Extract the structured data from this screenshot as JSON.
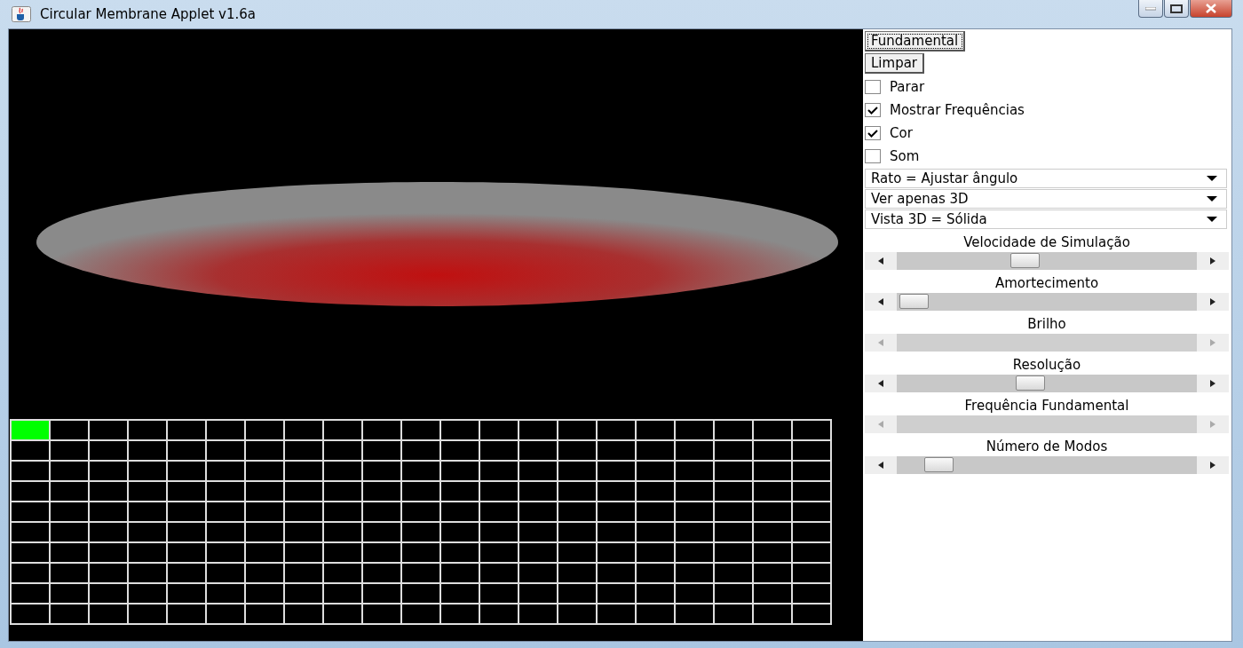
{
  "window": {
    "title": "Circular Membrane Applet v1.6a"
  },
  "buttons": [
    {
      "label": "Fundamental",
      "focused": true
    },
    {
      "label": "Limpar",
      "focused": false
    }
  ],
  "checkboxes": [
    {
      "label": "Parar",
      "checked": false
    },
    {
      "label": "Mostrar Frequências",
      "checked": true
    },
    {
      "label": "Cor",
      "checked": true
    },
    {
      "label": "Som",
      "checked": false
    }
  ],
  "dropdowns": [
    {
      "value": "Rato = Ajustar ângulo"
    },
    {
      "value": "Ver apenas 3D"
    },
    {
      "value": "Vista 3D = Sólida"
    }
  ],
  "sliders": [
    {
      "label": "Velocidade de Simulação",
      "disabled": false,
      "level": 0.42
    },
    {
      "label": "Amortecimento",
      "disabled": false,
      "level": 0.01
    },
    {
      "label": "Brilho",
      "disabled": true
    },
    {
      "label": "Resolução",
      "disabled": false,
      "level": 0.44
    },
    {
      "label": "Frequência Fundamental",
      "disabled": true
    },
    {
      "label": "Número de Modos",
      "disabled": false,
      "level": 0.1
    }
  ],
  "mode_grid": {
    "rows": [
      {
        "cells": [
          {
            "selected": true
          },
          {
            "selected": false
          },
          {
            "selected": false
          },
          {
            "selected": false
          },
          {
            "selected": false
          },
          {
            "selected": false
          },
          {
            "selected": false
          },
          {
            "selected": false
          },
          {
            "selected": false
          },
          {
            "selected": false
          },
          {
            "selected": false
          },
          {
            "selected": false
          },
          {
            "selected": false
          },
          {
            "selected": false
          },
          {
            "selected": false
          },
          {
            "selected": false
          },
          {
            "selected": false
          },
          {
            "selected": false
          },
          {
            "selected": false
          },
          {
            "selected": false
          },
          {
            "selected": false
          }
        ]
      },
      {
        "cells": [
          {
            "selected": false
          },
          {
            "selected": false
          },
          {
            "selected": false
          },
          {
            "selected": false
          },
          {
            "selected": false
          },
          {
            "selected": false
          },
          {
            "selected": false
          },
          {
            "selected": false
          },
          {
            "selected": false
          },
          {
            "selected": false
          },
          {
            "selected": false
          },
          {
            "selected": false
          },
          {
            "selected": false
          },
          {
            "selected": false
          },
          {
            "selected": false
          },
          {
            "selected": false
          },
          {
            "selected": false
          },
          {
            "selected": false
          },
          {
            "selected": false
          },
          {
            "selected": false
          },
          {
            "selected": false
          }
        ]
      },
      {
        "cells": [
          {
            "selected": false
          },
          {
            "selected": false
          },
          {
            "selected": false
          },
          {
            "selected": false
          },
          {
            "selected": false
          },
          {
            "selected": false
          },
          {
            "selected": false
          },
          {
            "selected": false
          },
          {
            "selected": false
          },
          {
            "selected": false
          },
          {
            "selected": false
          },
          {
            "selected": false
          },
          {
            "selected": false
          },
          {
            "selected": false
          },
          {
            "selected": false
          },
          {
            "selected": false
          },
          {
            "selected": false
          },
          {
            "selected": false
          },
          {
            "selected": false
          },
          {
            "selected": false
          },
          {
            "selected": false
          }
        ]
      },
      {
        "cells": [
          {
            "selected": false
          },
          {
            "selected": false
          },
          {
            "selected": false
          },
          {
            "selected": false
          },
          {
            "selected": false
          },
          {
            "selected": false
          },
          {
            "selected": false
          },
          {
            "selected": false
          },
          {
            "selected": false
          },
          {
            "selected": false
          },
          {
            "selected": false
          },
          {
            "selected": false
          },
          {
            "selected": false
          },
          {
            "selected": false
          },
          {
            "selected": false
          },
          {
            "selected": false
          },
          {
            "selected": false
          },
          {
            "selected": false
          },
          {
            "selected": false
          },
          {
            "selected": false
          },
          {
            "selected": false
          }
        ]
      },
      {
        "cells": [
          {
            "selected": false
          },
          {
            "selected": false
          },
          {
            "selected": false
          },
          {
            "selected": false
          },
          {
            "selected": false
          },
          {
            "selected": false
          },
          {
            "selected": false
          },
          {
            "selected": false
          },
          {
            "selected": false
          },
          {
            "selected": false
          },
          {
            "selected": false
          },
          {
            "selected": false
          },
          {
            "selected": false
          },
          {
            "selected": false
          },
          {
            "selected": false
          },
          {
            "selected": false
          },
          {
            "selected": false
          },
          {
            "selected": false
          },
          {
            "selected": false
          },
          {
            "selected": false
          },
          {
            "selected": false
          }
        ]
      },
      {
        "cells": [
          {
            "selected": false
          },
          {
            "selected": false
          },
          {
            "selected": false
          },
          {
            "selected": false
          },
          {
            "selected": false
          },
          {
            "selected": false
          },
          {
            "selected": false
          },
          {
            "selected": false
          },
          {
            "selected": false
          },
          {
            "selected": false
          },
          {
            "selected": false
          },
          {
            "selected": false
          },
          {
            "selected": false
          },
          {
            "selected": false
          },
          {
            "selected": false
          },
          {
            "selected": false
          },
          {
            "selected": false
          },
          {
            "selected": false
          },
          {
            "selected": false
          },
          {
            "selected": false
          },
          {
            "selected": false
          }
        ]
      },
      {
        "cells": [
          {
            "selected": false
          },
          {
            "selected": false
          },
          {
            "selected": false
          },
          {
            "selected": false
          },
          {
            "selected": false
          },
          {
            "selected": false
          },
          {
            "selected": false
          },
          {
            "selected": false
          },
          {
            "selected": false
          },
          {
            "selected": false
          },
          {
            "selected": false
          },
          {
            "selected": false
          },
          {
            "selected": false
          },
          {
            "selected": false
          },
          {
            "selected": false
          },
          {
            "selected": false
          },
          {
            "selected": false
          },
          {
            "selected": false
          },
          {
            "selected": false
          },
          {
            "selected": false
          },
          {
            "selected": false
          }
        ]
      },
      {
        "cells": [
          {
            "selected": false
          },
          {
            "selected": false
          },
          {
            "selected": false
          },
          {
            "selected": false
          },
          {
            "selected": false
          },
          {
            "selected": false
          },
          {
            "selected": false
          },
          {
            "selected": false
          },
          {
            "selected": false
          },
          {
            "selected": false
          },
          {
            "selected": false
          },
          {
            "selected": false
          },
          {
            "selected": false
          },
          {
            "selected": false
          },
          {
            "selected": false
          },
          {
            "selected": false
          },
          {
            "selected": false
          },
          {
            "selected": false
          },
          {
            "selected": false
          },
          {
            "selected": false
          },
          {
            "selected": false
          }
        ]
      },
      {
        "cells": [
          {
            "selected": false
          },
          {
            "selected": false
          },
          {
            "selected": false
          },
          {
            "selected": false
          },
          {
            "selected": false
          },
          {
            "selected": false
          },
          {
            "selected": false
          },
          {
            "selected": false
          },
          {
            "selected": false
          },
          {
            "selected": false
          },
          {
            "selected": false
          },
          {
            "selected": false
          },
          {
            "selected": false
          },
          {
            "selected": false
          },
          {
            "selected": false
          },
          {
            "selected": false
          },
          {
            "selected": false
          },
          {
            "selected": false
          },
          {
            "selected": false
          },
          {
            "selected": false
          },
          {
            "selected": false
          }
        ]
      },
      {
        "cells": [
          {
            "selected": false
          },
          {
            "selected": false
          },
          {
            "selected": false
          },
          {
            "selected": false
          },
          {
            "selected": false
          },
          {
            "selected": false
          },
          {
            "selected": false
          },
          {
            "selected": false
          },
          {
            "selected": false
          },
          {
            "selected": false
          },
          {
            "selected": false
          },
          {
            "selected": false
          },
          {
            "selected": false
          },
          {
            "selected": false
          },
          {
            "selected": false
          },
          {
            "selected": false
          },
          {
            "selected": false
          },
          {
            "selected": false
          },
          {
            "selected": false
          },
          {
            "selected": false
          },
          {
            "selected": false
          }
        ]
      }
    ]
  }
}
